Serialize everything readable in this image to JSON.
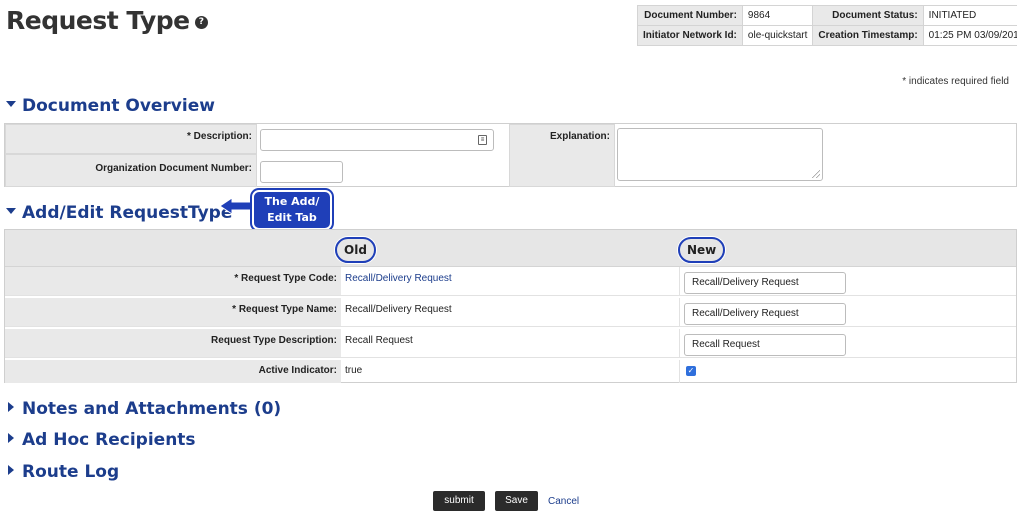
{
  "page": {
    "title": "Request Type",
    "help_icon": "?"
  },
  "doc_info": {
    "doc_number_label": "Document Number:",
    "doc_number": "9864",
    "doc_status_label": "Document Status:",
    "doc_status": "INITIATED",
    "initiator_label": "Initiator Network Id:",
    "initiator": "ole-quickstart",
    "created_label": "Creation Timestamp:",
    "created": "01:25 PM 03/09/2015"
  },
  "required_note": "* indicates required field",
  "overview": {
    "header": "Document Overview",
    "description_label": "* Description:",
    "description_value": "",
    "org_doc_label": "Organization Document Number:",
    "org_doc_value": "",
    "explanation_label": "Explanation:",
    "explanation_value": ""
  },
  "edit_section": {
    "header": "Add/Edit RequestType",
    "old_label": "Old",
    "new_label": "New",
    "rows": [
      {
        "label": "* Request Type Code:",
        "old": "Recall/Delivery Request",
        "new": "Recall/Delivery Request"
      },
      {
        "label": "* Request Type Name:",
        "old": "Recall/Delivery Request",
        "new": "Recall/Delivery Request"
      },
      {
        "label": "Request Type Description:",
        "old": "Recall Request",
        "new": "Recall Request"
      },
      {
        "label": "Active Indicator:",
        "old": "true",
        "new_checked": true
      }
    ]
  },
  "callout": {
    "line1": "The Add/",
    "line2": "Edit Tab"
  },
  "collapsed_sections": {
    "notes": "Notes and Attachments (0)",
    "adhoc": "Ad Hoc Recipients",
    "route_log": "Route Log"
  },
  "actions": {
    "submit": "submit",
    "save": "Save",
    "cancel": "Cancel"
  },
  "colors": {
    "section_blue": "#1c3d8c",
    "callout_blue": "#1f3fb8",
    "checkbox_blue": "#2f6fdc"
  }
}
